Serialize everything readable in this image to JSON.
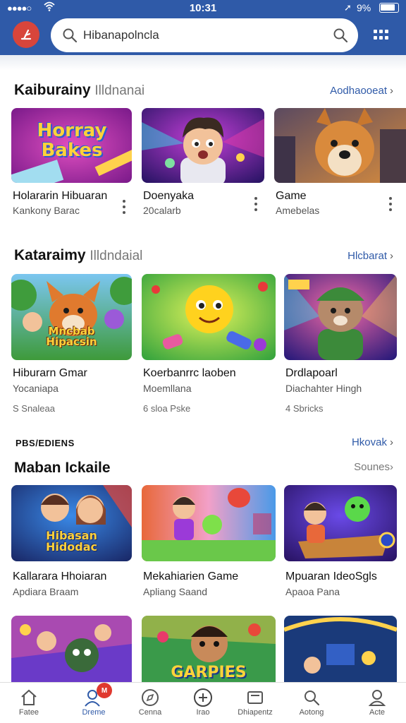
{
  "status_bar": {
    "time": "10:31",
    "battery": "9%",
    "signal": "●●●●○"
  },
  "header": {
    "search_value": "Hibanapolncla"
  },
  "sections": [
    {
      "title": "Kaiburainy",
      "subtitle": "Illdnanai",
      "link": "Aodhaooeat",
      "cards": [
        {
          "title": "Holararin Hibuaran",
          "sub": "Kankony Barac",
          "art": "Horray Bakes"
        },
        {
          "title": "Doenyaka",
          "sub": "20calarb"
        },
        {
          "title": "Game",
          "sub": "Amebelas"
        }
      ]
    },
    {
      "title": "Kataraimy",
      "subtitle": "Illdndaial",
      "link": "Hlcbarat",
      "cards": [
        {
          "title": "Hiburarn Gmar",
          "sub": "Yocaniapa",
          "meta": "S Snaleaa",
          "art": "Mncbab Hipacsin"
        },
        {
          "title": "Koerbanrrc laoben",
          "sub": "Moemllana",
          "meta": "6 sloa Pske"
        },
        {
          "title": "Drdlapoarl",
          "sub": "Diachahter Hingh",
          "meta": "4 Sbricks"
        }
      ]
    },
    {
      "overline": "PBS/EDIENS",
      "overline_link": "Hkovak",
      "title": "Maban Ickaile",
      "link": "Sounes",
      "cards": [
        {
          "title": "Kallarara Hhoiaran",
          "sub": "Apdiara Braam",
          "art": "Hibasan Hidodac"
        },
        {
          "title": "Mekahiarien Game",
          "sub": "Apliang Saand"
        },
        {
          "title": "Mpuaran IdeoSgls",
          "sub": "Apaoa Pana"
        }
      ]
    },
    {
      "cards": [
        {
          "title": ""
        },
        {
          "title": "",
          "art": "GARPIES"
        },
        {
          "title": ""
        }
      ]
    }
  ],
  "bottom_nav": [
    {
      "label": "Fatee",
      "icon": "home-icon"
    },
    {
      "label": "Dreme",
      "icon": "profile-chat-icon",
      "badge": "M",
      "active": true
    },
    {
      "label": "Cenna",
      "icon": "compass-icon"
    },
    {
      "label": "Irao",
      "icon": "plus-circle-icon"
    },
    {
      "label": "Dhiapentz",
      "icon": "tray-icon"
    },
    {
      "label": "Aotong",
      "icon": "search-icon"
    },
    {
      "label": "Acte",
      "icon": "user-icon"
    }
  ],
  "colors": {
    "header": "#2f5aa8",
    "accent": "#2f5aa8",
    "badge": "#e0392f",
    "logo": "#d8453b"
  }
}
